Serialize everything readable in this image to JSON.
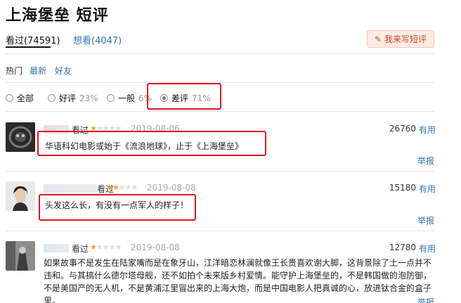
{
  "page": {
    "title": "上海堡垒 短评"
  },
  "tabs": [
    {
      "label": "看过(74591)",
      "active": true
    },
    {
      "label": "想看(4047)",
      "active": false
    }
  ],
  "write_button": {
    "label": "我来写短评",
    "icon": "pencil-icon"
  },
  "sort": [
    {
      "label": "热门",
      "active": true
    },
    {
      "label": "最新",
      "active": false
    },
    {
      "label": "好友",
      "active": false
    }
  ],
  "filters": [
    {
      "label": "全部",
      "pct": "",
      "checked": false
    },
    {
      "label": "好评",
      "pct": "23%",
      "checked": false
    },
    {
      "label": "一般",
      "pct": "6%",
      "checked": false
    },
    {
      "label": "差评",
      "pct": "71%",
      "checked": true
    }
  ],
  "comments": [
    {
      "status": "看过",
      "rating_stars": 1,
      "date": "2019-08-06",
      "votes": "26760",
      "useful_label": "有用",
      "text": "华语科幻电影或始于《流浪地球》，止于《上海堡垒》",
      "report_label": "举报"
    },
    {
      "status": "看过",
      "rating_stars": 2,
      "date": "2019-08-08",
      "votes": "15180",
      "useful_label": "有用",
      "text": "头发这么长，有没有一点军人的样子！",
      "report_label": "举报"
    },
    {
      "status": "看过",
      "rating_stars": 1,
      "date": "2019-08-08",
      "votes": "12780",
      "useful_label": "有用",
      "text": "如果故事不是发生在陆家嘴而是在象牙山，江洋暗恋林澜就像王长贵喜欢谢大脚，这背景除了土一点并不违和。与其搞什么德尔塔母舰，还不如拍个未来版乡村爱情。能守护上海堡垒的，不是韩国做的泡防御，不是美国产的无人机，不是黄浦江里冒出来的上海大炮，而是中国电影人把真诚的心，放进钛合金的盒子里。",
      "report_label": "举报"
    }
  ],
  "colors": {
    "link": "#3377aa",
    "star": "#f2a22c",
    "highlight_box": "#e0161f",
    "write_button_bg": "#fdebe4"
  }
}
